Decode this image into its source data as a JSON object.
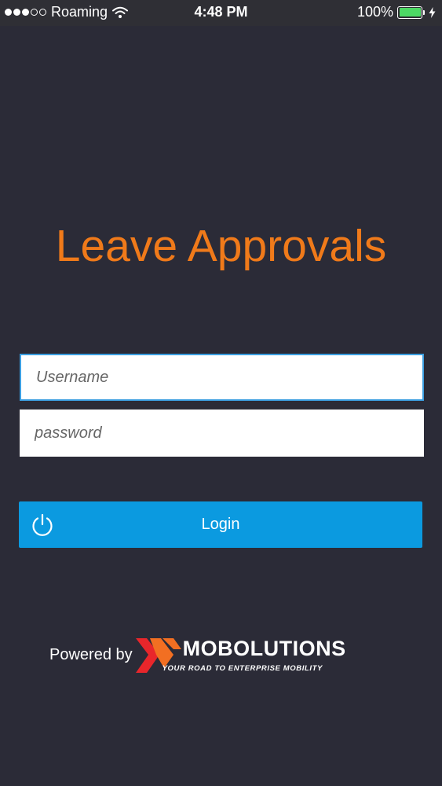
{
  "status_bar": {
    "carrier": "Roaming",
    "time": "4:48 PM",
    "battery_percent": "100%",
    "battery_level": 1.0,
    "signal_bars_filled": 3,
    "signal_bars_total": 5,
    "icons": [
      "wifi-icon",
      "battery-icon",
      "charging-bolt-icon"
    ]
  },
  "app": {
    "title": "Leave Approvals"
  },
  "form": {
    "username_placeholder": "Username",
    "username_value": "",
    "password_placeholder": "password",
    "password_value": "",
    "login_label": "Login",
    "login_icon": "power-icon"
  },
  "footer": {
    "powered_by": "Powered by",
    "brand_name": "MOBOLUTIONS",
    "brand_tagline": "YOUR ROAD TO ENTERPRISE MOBILITY"
  },
  "colors": {
    "background": "#2b2b37",
    "status_bar": "#2f2f35",
    "title": "#f07a1a",
    "button": "#0b9ae0",
    "input_focus_border": "#3b9ee0",
    "battery_fill": "#4cd964",
    "logo_red": "#e8262b",
    "logo_orange": "#f26f22"
  }
}
